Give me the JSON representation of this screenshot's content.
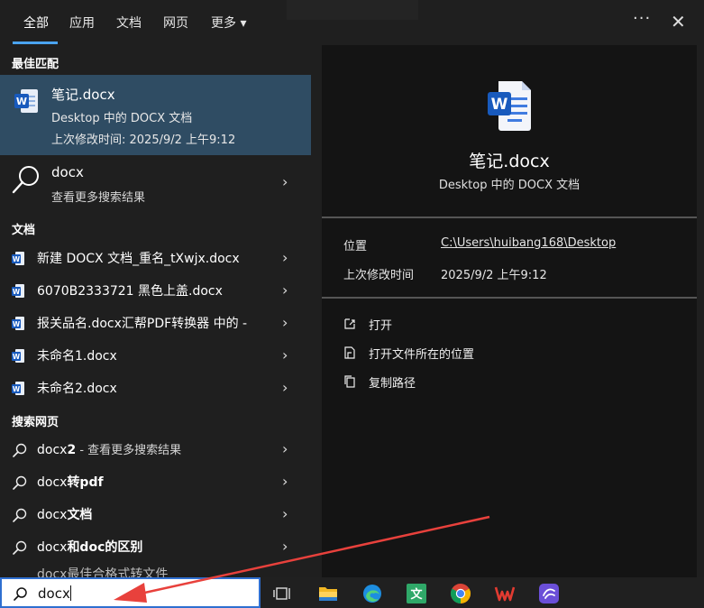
{
  "tabs": [
    {
      "label": "全部",
      "active": true
    },
    {
      "label": "应用",
      "active": false
    },
    {
      "label": "文档",
      "active": false
    },
    {
      "label": "网页",
      "active": false
    },
    {
      "label": "更多",
      "active": false
    }
  ],
  "tab_more_caret": "▾",
  "header": {
    "more_icon": "ellipsis-icon",
    "close_icon": "close-icon"
  },
  "sections": {
    "best_match": "最佳匹配",
    "documents": "文档",
    "web": "搜索网页"
  },
  "best_match": {
    "title": "笔记.docx",
    "subtitle": "Desktop 中的 DOCX 文档",
    "modified": "上次修改时间: 2025/9/2 上午9:12"
  },
  "docx_search": {
    "title": "docx",
    "subtitle": "查看更多搜索结果"
  },
  "documents": [
    "新建 DOCX 文档_重名_tXwjx.docx",
    "6070B2333721 黑色上盖.docx",
    "报关品名.docx汇帮PDF转换器 中的 -",
    "未命名1.docx",
    "未命名2.docx"
  ],
  "web": [
    {
      "normal": "docx",
      "bold": "2",
      "hint": " - 查看更多搜索结果",
      "tail": ""
    },
    {
      "normal": "docx",
      "bold": "转pdf",
      "hint": "",
      "tail": ""
    },
    {
      "normal": "docx",
      "bold": "文档",
      "hint": "",
      "tail": ""
    },
    {
      "normal": "docx",
      "bold": "和doc的区别",
      "hint": "",
      "tail": ""
    }
  ],
  "cut_row": "docx最佳合格式转文件",
  "preview": {
    "title": "笔记.docx",
    "subtitle": "Desktop 中的 DOCX 文档",
    "location_label": "位置",
    "location_value": "C:\\Users\\huibang168\\Desktop",
    "modified_label": "上次修改时间",
    "modified_value": "2025/9/2 上午9:12",
    "actions": [
      "打开",
      "打开文件所在的位置",
      "复制路径"
    ]
  },
  "search": {
    "value": "docx"
  },
  "colors": {
    "accent": "#4aa3f0",
    "selected": "#2f4c63",
    "word_blue": "#185abd",
    "annotation": "#e8413c"
  },
  "taskbar_icons": [
    "task-view-icon",
    "file-explorer-icon",
    "edge-icon",
    "wps-text-icon",
    "chrome-icon",
    "wps-office-icon",
    "app-icon"
  ]
}
